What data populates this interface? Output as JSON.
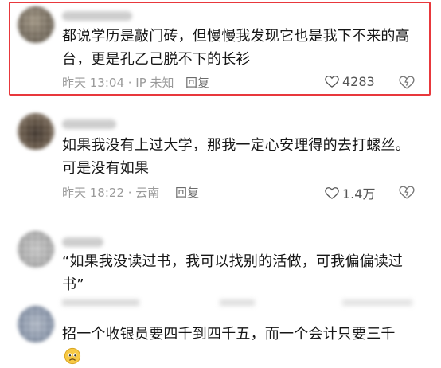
{
  "comments": [
    {
      "text": "都说学历是敲门砖，但慢慢我发现它也是我下不来的高台，更是孔乙己脱不下的长衫",
      "meta": "昨天 13:04 · IP 未知",
      "reply_label": "回复",
      "like_count": "4283",
      "highlighted": true
    },
    {
      "text": "如果我没有上过大学，那我一定心安理得的去打螺丝。可是没有如果",
      "meta": "昨天 18:22 · 云南",
      "reply_label": "回复",
      "like_count": "1.4万"
    },
    {
      "text": "“如果我没读过书，我可以找别的活做，可我偏偏读过书”"
    },
    {
      "text": "招一个收银员要四千到四千五，而一个会计只要三千",
      "emoji": "sad-face-emoji"
    }
  ],
  "colors": {
    "highlight_border": "#e8383c",
    "body_text": "#161616",
    "meta_text": "#9a9a9a"
  }
}
